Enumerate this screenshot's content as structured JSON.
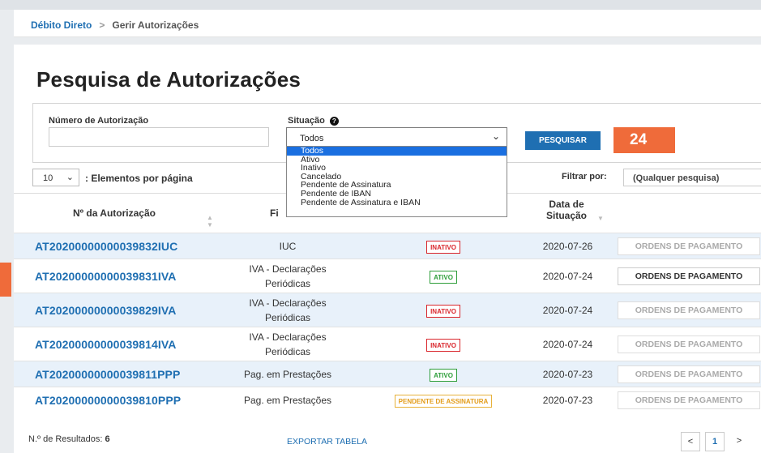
{
  "breadcrumb": {
    "root": "Débito Direto",
    "sep": ">",
    "current": "Gerir Autorizações"
  },
  "page_title": "Pesquisa de Autorizações",
  "filters": {
    "auth_label": "Número de Autorização",
    "auth_value": "",
    "situacao_label": "Situação",
    "situacao_value": "Todos",
    "situacao_options": [
      "Todos",
      "Ativo",
      "Inativo",
      "Cancelado",
      "Pendente de Assinatura",
      "Pendente de IBAN",
      "Pendente de Assinatura e IBAN"
    ],
    "search_button": "PESQUISAR"
  },
  "annotation_badge": "24",
  "per_page": {
    "value": "10",
    "label": ": Elementos por página"
  },
  "filter_by": {
    "label": "Filtrar por:",
    "placeholder": "(Qualquer pesquisa)"
  },
  "table": {
    "headers": [
      "Nº da Autorização",
      "Fi",
      "Data de",
      "Situação"
    ],
    "rows": [
      {
        "id": "AT20200000000039832IUC",
        "fin": [
          "IUC"
        ],
        "status": "INATIVO",
        "status_kind": "in",
        "date": "2020-07-26",
        "action": "ORDENS DE PAGAMENTO",
        "action_enabled": false
      },
      {
        "id": "AT20200000000039831IVA",
        "fin": [
          "IVA - Declarações",
          "Periódicas"
        ],
        "status": "ATIVO",
        "status_kind": "ac",
        "date": "2020-07-24",
        "action": "ORDENS DE PAGAMENTO",
        "action_enabled": true
      },
      {
        "id": "AT20200000000039829IVA",
        "fin": [
          "IVA - Declarações",
          "Periódicas"
        ],
        "status": "INATIVO",
        "status_kind": "in",
        "date": "2020-07-24",
        "action": "ORDENS DE PAGAMENTO",
        "action_enabled": false
      },
      {
        "id": "AT20200000000039814IVA",
        "fin": [
          "IVA - Declarações",
          "Periódicas"
        ],
        "status": "INATIVO",
        "status_kind": "in",
        "date": "2020-07-24",
        "action": "ORDENS DE PAGAMENTO",
        "action_enabled": false
      },
      {
        "id": "AT20200000000039811PPP",
        "fin": [
          "Pag. em Prestações"
        ],
        "status": "ATIVO",
        "status_kind": "ac",
        "date": "2020-07-23",
        "action": "ORDENS DE PAGAMENTO",
        "action_enabled": false
      },
      {
        "id": "AT20200000000039810PPP",
        "fin": [
          "Pag. em Prestações"
        ],
        "status": "PENDENTE DE ASSINATURA",
        "status_kind": "pe",
        "date": "2020-07-23",
        "action": "ORDENS DE PAGAMENTO",
        "action_enabled": false
      }
    ]
  },
  "footer": {
    "results_label": "N.º de Resultados:",
    "results_count": "6",
    "export": "EXPORTAR TABELA"
  },
  "pagination": {
    "prev": "<",
    "page": "1",
    "next": ">"
  },
  "colors": {
    "accent": "#1f6fb2",
    "annotation": "#ef6b3a",
    "inactive": "#d9262c",
    "active": "#2e9e3a",
    "pending": "#e39c1a"
  },
  "icons": {
    "help": "help-circle-icon",
    "chevron": "chevron-down-icon",
    "sort": "sort-icon"
  }
}
